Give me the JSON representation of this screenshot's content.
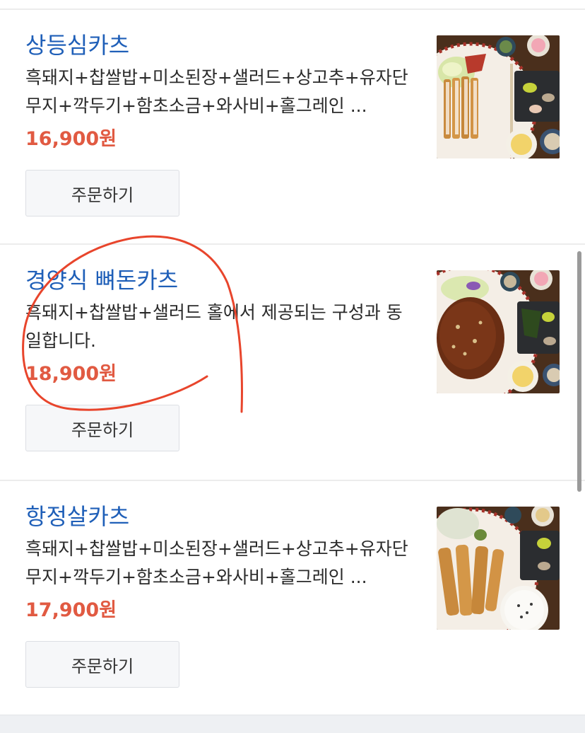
{
  "menu": {
    "items": [
      {
        "name": "상등심카츠",
        "description": "흑돼지+찹쌀밥+미소된장+샐러드+상고추+유자단무지+깍두기+함초소금+와사비+홀그레인 ...",
        "price": "16,900원",
        "order_label": "주문하기",
        "image_icon": "pork-cutlet-plate-image"
      },
      {
        "name": "경양식 뼈돈카츠",
        "description": "흑돼지+찹쌀밥+샐러드 홀에서 제공되는 구성과 동일합니다.",
        "price": "18,900원",
        "order_label": "주문하기",
        "image_icon": "sauced-cutlet-plate-image"
      },
      {
        "name": "항정살카츠",
        "description": "흑돼지+찹쌀밥+미소된장+샐러드+상고추+유자단무지+깍두기+함초소금+와사비+홀그레인 ...",
        "price": "17,900원",
        "order_label": "주문하기",
        "image_icon": "jowl-cutlet-plate-image"
      }
    ]
  },
  "colors": {
    "name": "#1f5fb8",
    "price": "#e15a42",
    "annotation": "#e8452c"
  }
}
